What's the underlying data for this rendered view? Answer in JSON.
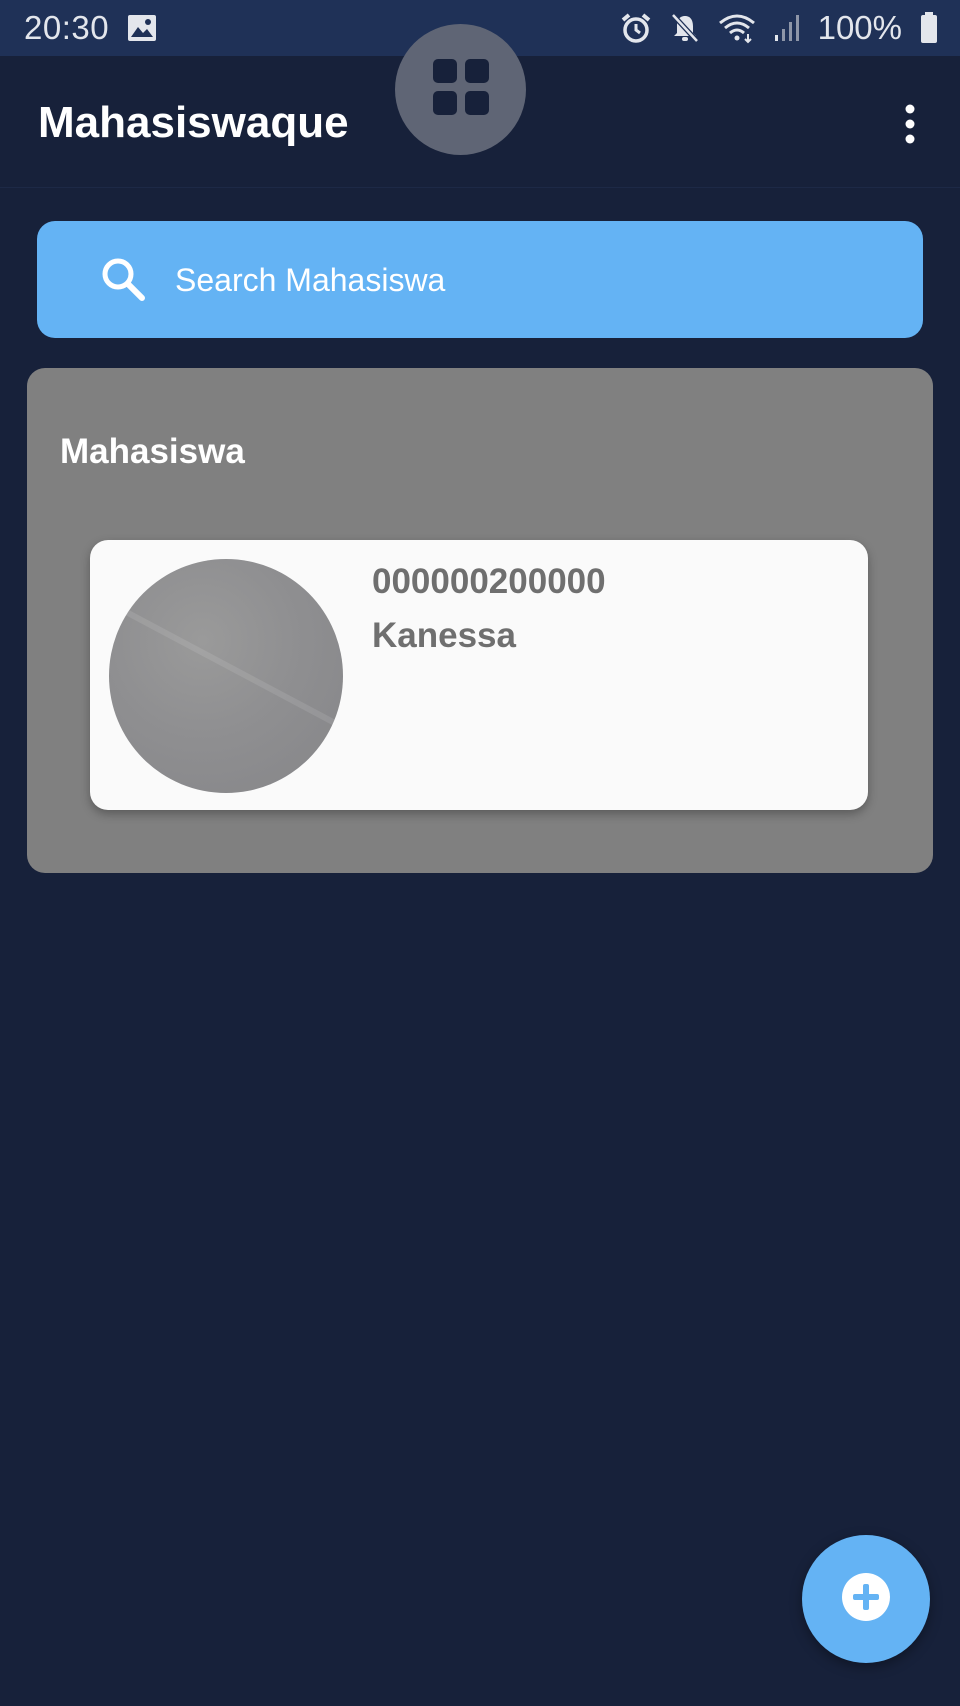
{
  "status_bar": {
    "time": "20:30",
    "battery": "100%",
    "icons": [
      "gallery-icon",
      "alarm-icon",
      "mute-icon",
      "wifi-icon",
      "signal-icon",
      "battery-icon"
    ]
  },
  "app_bar": {
    "title": "Mahasiswaque",
    "menu_icon": "more-vert-icon"
  },
  "overlay": {
    "icon": "grid-icon"
  },
  "search": {
    "placeholder": "Search Mahasiswa",
    "value": ""
  },
  "section": {
    "title": "Mahasiswa"
  },
  "students": [
    {
      "id": "000000200000",
      "name": "Kanessa"
    }
  ],
  "fab": {
    "icon": "add-circle-icon"
  },
  "colors": {
    "background": "#17213a",
    "status_bar": "#1f3157",
    "accent": "#64b3f4",
    "section_bg": "#808080",
    "card_bg": "#fafafa",
    "card_text": "#6f6f6f"
  }
}
